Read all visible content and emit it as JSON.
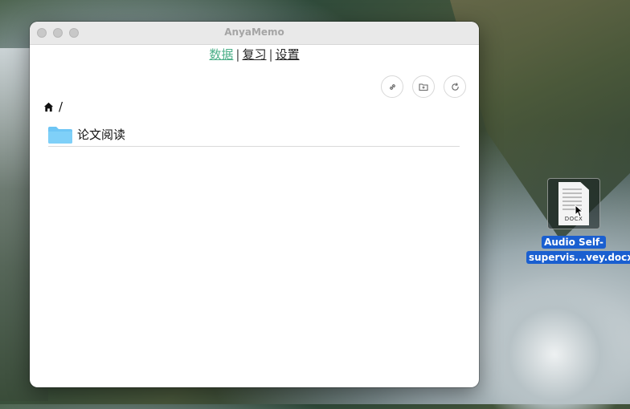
{
  "window": {
    "title": "AnyaMemo"
  },
  "nav": {
    "items": [
      {
        "label": "数据"
      },
      {
        "label": "复习"
      },
      {
        "label": "设置"
      }
    ],
    "separator": "|"
  },
  "toolbar": {
    "buttons": [
      {
        "icon": "link-icon"
      },
      {
        "icon": "folder-plus-icon"
      },
      {
        "icon": "refresh-icon"
      }
    ]
  },
  "breadcrumb": {
    "home_icon": "home-icon",
    "path": "/"
  },
  "folders": [
    {
      "name": "论文阅读",
      "icon": "folder-icon"
    }
  ],
  "desktop": {
    "file": {
      "type_label": "DOCX",
      "name_line1": "Audio Self-",
      "name_line2": "supervis...vey.docx"
    }
  },
  "colors": {
    "accent": "#4caf88",
    "folder": "#6ec6f5",
    "selection": "#1a5fd0"
  }
}
